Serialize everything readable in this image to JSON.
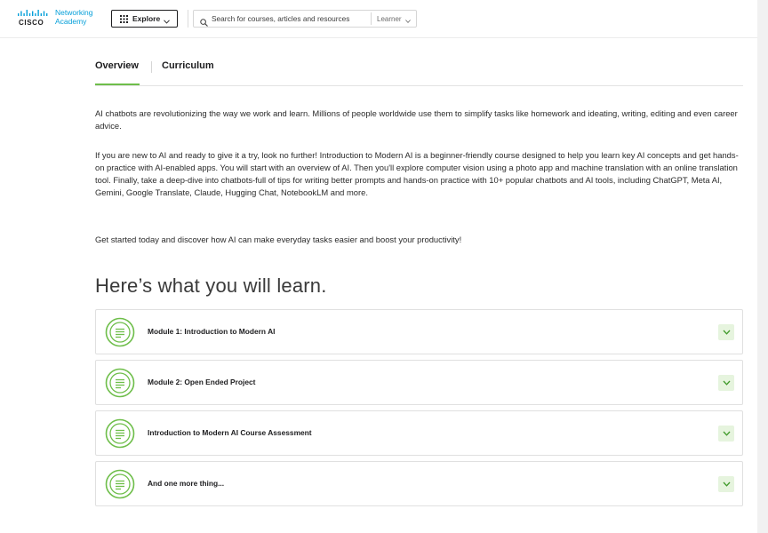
{
  "header": {
    "logo": {
      "wordmark": "CISCO",
      "brand_line1": "Networking",
      "brand_line2": "Academy"
    },
    "explore_label": "Explore",
    "search": {
      "placeholder": "Search for courses, articles and resources"
    },
    "role_select": {
      "selected": "Learner"
    }
  },
  "tabs": [
    {
      "label": "Overview",
      "active": true
    },
    {
      "label": "Curriculum",
      "active": false
    }
  ],
  "overview": {
    "paragraphs": [
      "AI chatbots are revolutionizing the way we work and learn. Millions of people worldwide use them to simplify tasks like homework and ideating, writing, editing and even career advice.",
      "If you are new to AI and ready to give it a try, look no further! Introduction to Modern AI is a beginner-friendly course designed to help you learn key AI concepts and get hands-on practice with AI-enabled apps. You will start with an overview of AI. Then you'll explore computer vision using a photo app and machine translation with an online translation tool. Finally, take a deep-dive into chatbots-full of tips for writing better prompts and hands-on practice with 10+ popular chatbots and AI tools, including ChatGPT, Meta AI, Gemini, Google Translate, Claude, Hugging Chat, NotebookLM and more.",
      "Get started today and discover how AI can make everyday tasks easier and boost your productivity!"
    ]
  },
  "learn": {
    "heading": "Here’s what you will learn.",
    "modules": [
      {
        "title": "Module 1: Introduction to Modern AI",
        "icon": "document-lines-icon"
      },
      {
        "title": "Module 2: Open Ended Project",
        "icon": "document-lines-icon"
      },
      {
        "title": "Introduction to Modern AI Course Assessment",
        "icon": "document-lines-icon"
      },
      {
        "title": "And one more thing...",
        "icon": "document-lines-icon"
      }
    ]
  },
  "colors": {
    "accent_green": "#6ebe4a",
    "brand_blue": "#049fd9",
    "expand_bg": "#e6f4de"
  }
}
